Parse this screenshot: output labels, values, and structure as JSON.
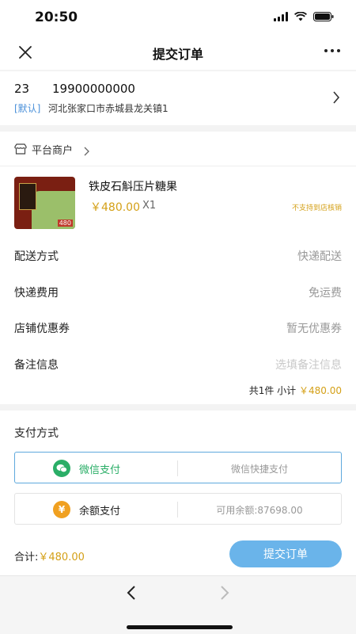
{
  "status_bar": {
    "time": "20:50"
  },
  "header": {
    "title": "提交订单"
  },
  "address": {
    "name": "23",
    "phone": "19900000000",
    "tag": "[默认]",
    "detail": "河北张家口市赤城县龙关镇1"
  },
  "shop": {
    "name": "平台商户"
  },
  "product": {
    "title": "铁皮石斛压片糖果",
    "price": "￥480.00",
    "qty": "X1",
    "note": "不支持到店核销",
    "image_price": "480"
  },
  "order_rows": [
    {
      "label": "配送方式",
      "value": "快递配送"
    },
    {
      "label": "快递费用",
      "value": "免运费"
    },
    {
      "label": "店铺优惠券",
      "value": "暂无优惠券"
    },
    {
      "label": "备注信息",
      "placeholder": "选填备注信息"
    }
  ],
  "subtotal": {
    "label": "共1件 小计",
    "amount": "￥480.00"
  },
  "payment": {
    "title": "支付方式",
    "options": [
      {
        "label": "微信支付",
        "sub": "微信快捷支付",
        "color": "#2aae67",
        "icon": "wechat-icon",
        "selected": true
      },
      {
        "label": "余额支付",
        "sub": "可用余额:87698.00",
        "color": "#f0a020",
        "icon": "yen-icon",
        "selected": false
      }
    ]
  },
  "footer": {
    "total_label": "合计:",
    "total_amount": "￥480.00",
    "submit_label": "提交订单"
  },
  "colors": {
    "accent": "#6ab4ea",
    "price": "#d4a017",
    "wechat": "#2aae67",
    "balance": "#f0a020"
  }
}
